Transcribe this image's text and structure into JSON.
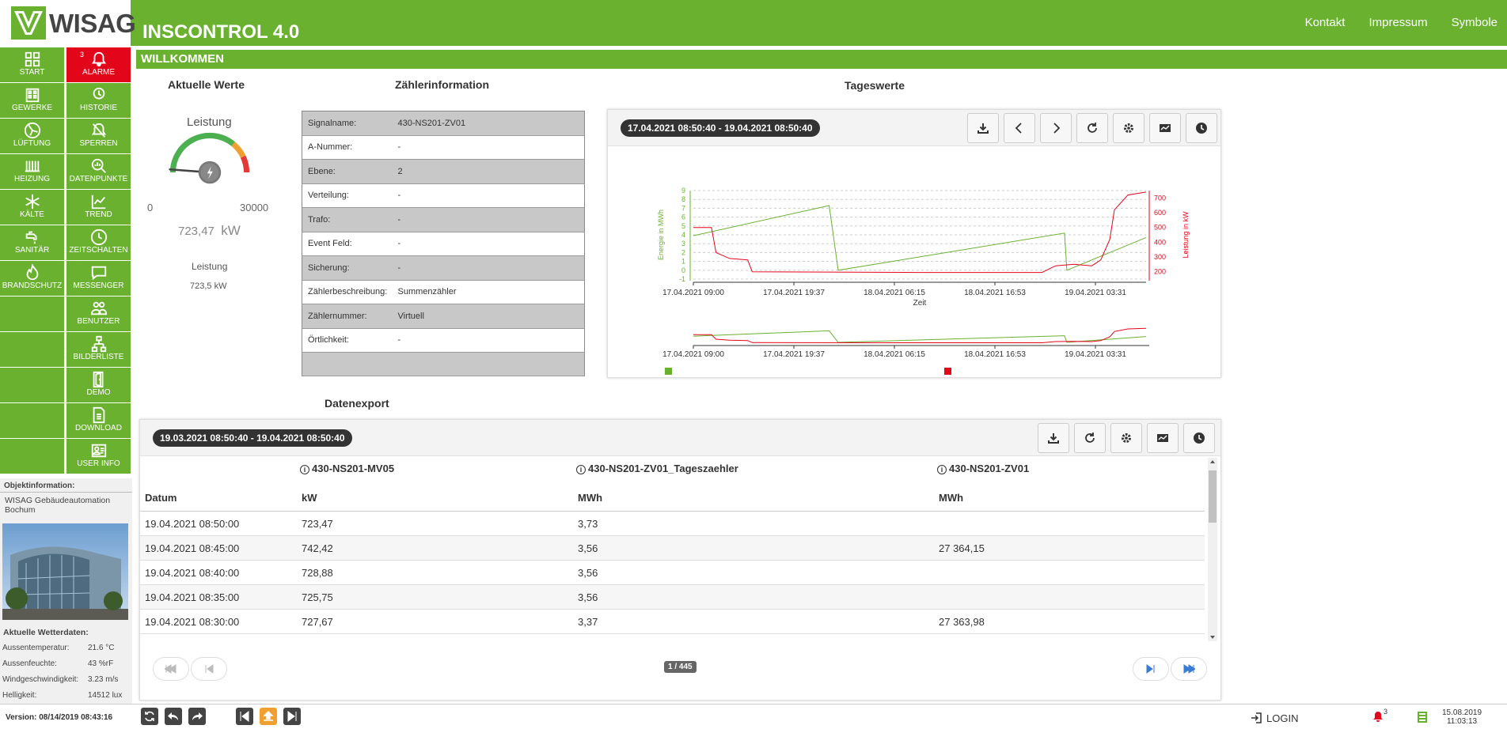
{
  "header": {
    "logo": "WISAG",
    "title": "INSCONTROL 4.0",
    "nav": [
      "Kontakt",
      "Impressum",
      "Symbole"
    ]
  },
  "sidebar": {
    "tiles": [
      {
        "label": "START",
        "icon": "grid-icon"
      },
      {
        "label": "ALARME",
        "icon": "bell-alarm-icon",
        "badge": "3"
      },
      {
        "label": "GEWERKE",
        "icon": "building-icon"
      },
      {
        "label": "HISTORIE",
        "icon": "bell-history-icon"
      },
      {
        "label": "LÜFTUNG",
        "icon": "fan-icon"
      },
      {
        "label": "SPERREN",
        "icon": "bell-off-icon"
      },
      {
        "label": "HEIZUNG",
        "icon": "radiator-icon"
      },
      {
        "label": "DATENPUNKTE",
        "icon": "search-chart-icon"
      },
      {
        "label": "KÄLTE",
        "icon": "snowflake-icon"
      },
      {
        "label": "TREND",
        "icon": "trend-chart-icon"
      },
      {
        "label": "SANITÄR",
        "icon": "faucet-icon"
      },
      {
        "label": "ZEITSCHALTEN",
        "icon": "clock-icon"
      },
      {
        "label": "BRANDSCHUTZ",
        "icon": "flame-icon"
      },
      {
        "label": "MESSENGER",
        "icon": "message-icon"
      },
      {
        "label": "",
        "icon": ""
      },
      {
        "label": "BENUTZER",
        "icon": "users-icon"
      },
      {
        "label": "",
        "icon": ""
      },
      {
        "label": "BILDERLISTE",
        "icon": "sitemap-icon"
      },
      {
        "label": "",
        "icon": ""
      },
      {
        "label": "DEMO",
        "icon": "door-icon"
      },
      {
        "label": "",
        "icon": ""
      },
      {
        "label": "DOWNLOAD",
        "icon": "download-doc-icon"
      },
      {
        "label": "",
        "icon": ""
      },
      {
        "label": "USER INFO",
        "icon": "user-card-icon"
      }
    ]
  },
  "object_info": {
    "heading": "Objektinformation:",
    "name": "WISAG Gebäudeautomation Bochum",
    "weather_heading": "Aktuelle Wetterdaten:",
    "weather": [
      {
        "key": "Aussentemperatur:",
        "value": "21.6 °C"
      },
      {
        "key": "Aussenfeuchte:",
        "value": "43 %rF"
      },
      {
        "key": "Windgeschwindigkeit:",
        "value": "3.23 m/s"
      },
      {
        "key": "Helligkeit:",
        "value": "14512 lux"
      }
    ]
  },
  "main": {
    "banner": "WILLKOMMEN",
    "current_values": {
      "title": "Aktuelle Werte",
      "gauge_label": "Leistung",
      "gauge_min": "0",
      "gauge_max": "30000",
      "gauge_value": "723,47",
      "gauge_unit": "kW",
      "gauge_fraction": 0.024,
      "label": "Leistung",
      "value": "723,5 kW"
    },
    "meter_info": {
      "title": "Zählerinformation",
      "rows": [
        {
          "key": "Signalname:",
          "value": "430-NS201-ZV01"
        },
        {
          "key": "A-Nummer:",
          "value": "-"
        },
        {
          "key": "Ebene:",
          "value": "2"
        },
        {
          "key": "Verteilung:",
          "value": "-"
        },
        {
          "key": "Trafo:",
          "value": "-"
        },
        {
          "key": "Event Feld:",
          "value": "-"
        },
        {
          "key": "Sicherung:",
          "value": "-"
        },
        {
          "key": "Zählerbeschreibung:",
          "value": "Summenzähler"
        },
        {
          "key": "Zählernummer:",
          "value": "Virtuell"
        },
        {
          "key": "Örtlichkeit:",
          "value": "-"
        }
      ]
    },
    "daily": {
      "title": "Tageswerte",
      "range": "17.04.2021 08:50:40 - 19.04.2021 08:50:40"
    },
    "export": {
      "title": "Datenexport",
      "range": "19.03.2021 08:50:40 - 19.04.2021 08:50:40",
      "columns": [
        {
          "name": "",
          "unit": "Datum"
        },
        {
          "name": "430-NS201-MV05",
          "unit": "kW"
        },
        {
          "name": "430-NS201-ZV01_Tageszaehler",
          "unit": "MWh"
        },
        {
          "name": "430-NS201-ZV01",
          "unit": "MWh"
        }
      ],
      "rows": [
        [
          "19.04.2021 08:50:00",
          "723,47",
          "3,73",
          ""
        ],
        [
          "19.04.2021 08:45:00",
          "742,42",
          "3,56",
          "27 364,15"
        ],
        [
          "19.04.2021 08:40:00",
          "728,88",
          "3,56",
          ""
        ],
        [
          "19.04.2021 08:35:00",
          "725,75",
          "3,56",
          ""
        ],
        [
          "19.04.2021 08:30:00",
          "727,67",
          "3,37",
          "27 363,98"
        ]
      ],
      "page": "1 / 445"
    }
  },
  "chart_data": {
    "type": "line",
    "xlabel": "Zeit",
    "x_ticks": [
      "17.04.2021 09:00",
      "17.04.2021 19:37",
      "18.04.2021 06:15",
      "18.04.2021 16:53",
      "19.04.2021 03:31"
    ],
    "y_left": {
      "label": "Energie in MWh",
      "ticks": [
        "-1",
        "0",
        "1",
        "2",
        "3",
        "4",
        "5",
        "6",
        "7",
        "8",
        "9"
      ],
      "color": "#6ab130"
    },
    "y_right": {
      "label": "Leistung in kW",
      "ticks": [
        "200",
        "300",
        "400",
        "500",
        "600",
        "700"
      ],
      "color": "#e3061a"
    },
    "series": [
      {
        "axis": "left",
        "color": "#6ab130",
        "x": [
          0,
          0.3,
          0.32,
          0.82,
          0.825,
          1
        ],
        "y": [
          3.9,
          7.3,
          0.0,
          4.2,
          0.0,
          3.7
        ]
      },
      {
        "axis": "right",
        "color": "#e3061a",
        "x": [
          0,
          0.04,
          0.05,
          0.08,
          0.12,
          0.13,
          0.5,
          0.77,
          0.8,
          0.84,
          0.88,
          0.9,
          0.92,
          0.93,
          0.96,
          1
        ],
        "y": [
          500,
          500,
          330,
          290,
          280,
          200,
          195,
          195,
          240,
          250,
          240,
          280,
          420,
          620,
          720,
          740
        ]
      }
    ],
    "grid": true,
    "legend": "bottom-left"
  },
  "footer": {
    "version": "Version: 08/14/2019 08:43:16",
    "login": "LOGIN",
    "alarm_count": "3",
    "date": "15.08.2019",
    "time": "11:03:13"
  }
}
